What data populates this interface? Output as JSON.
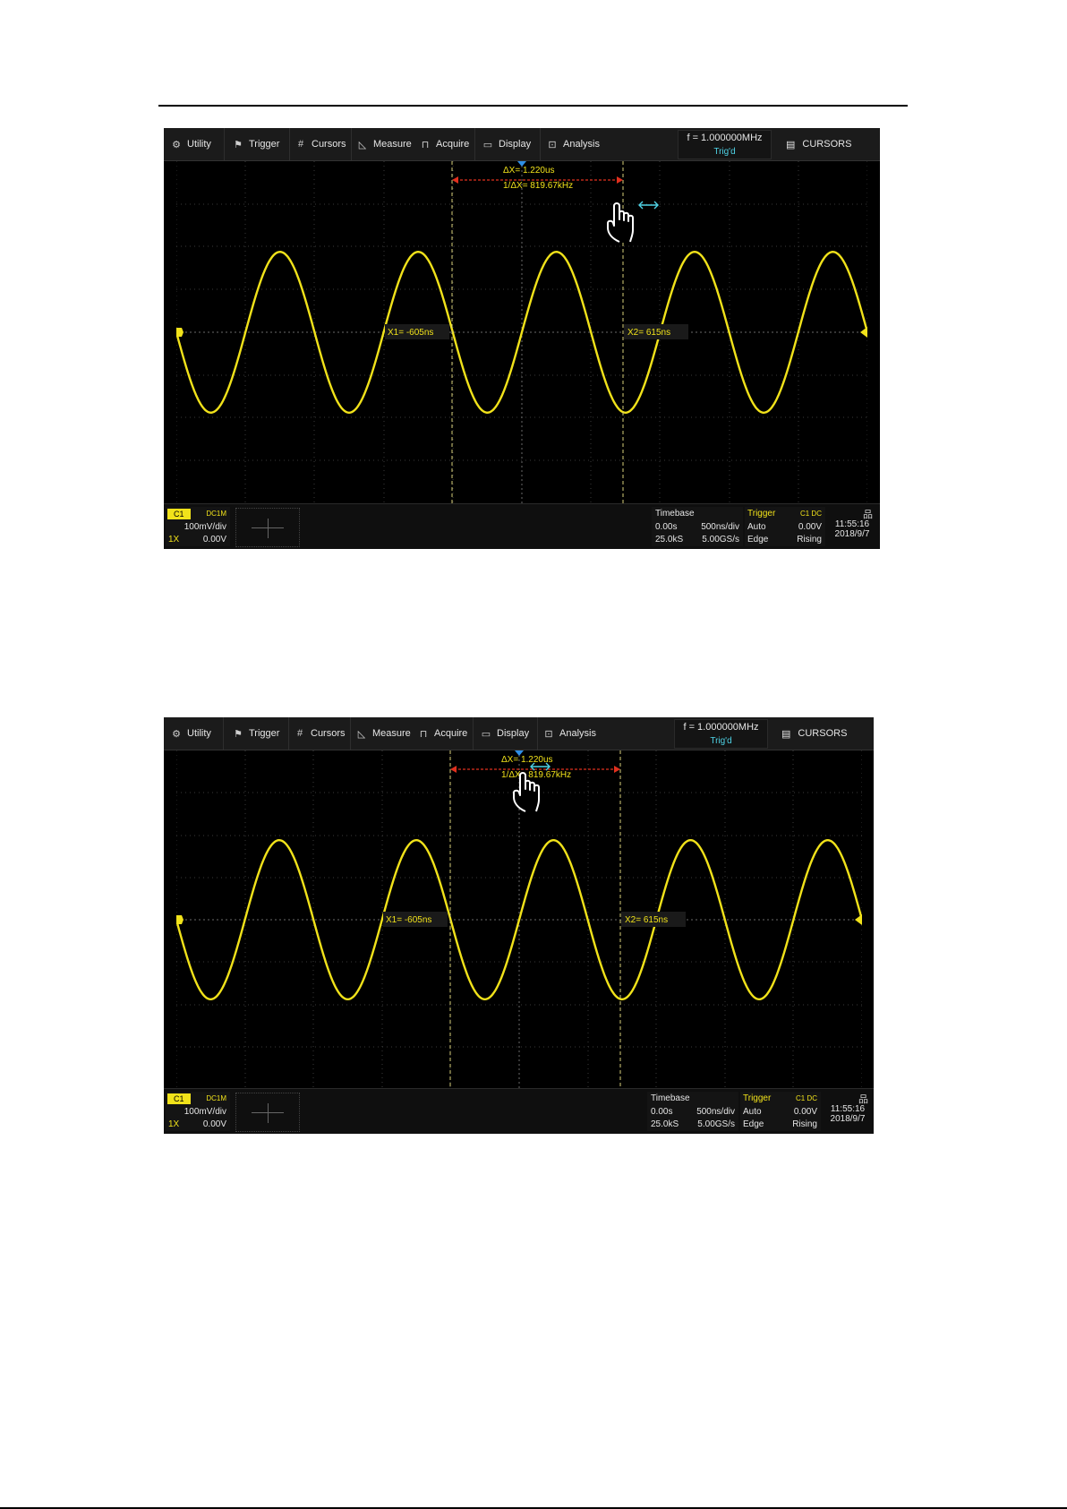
{
  "menubar": {
    "items": [
      {
        "label": "Utility",
        "icon": "gear-icon"
      },
      {
        "label": "Trigger",
        "icon": "flag-icon"
      },
      {
        "label": "Cursors",
        "icon": "grid-hash-icon"
      },
      {
        "label": "Measure",
        "icon": "ruler-triangle-icon"
      },
      {
        "label": "Acquire",
        "icon": "pulse-icon"
      },
      {
        "label": "Display",
        "icon": "monitor-icon"
      },
      {
        "label": "Analysis",
        "icon": "analysis-icon"
      }
    ],
    "frequency": "f = 1.000000MHz",
    "trigger_status": "Trig'd",
    "mode_button": "CURSORS"
  },
  "cursors": {
    "delta_x": "ΔX= 1.220us",
    "inverse_delta_x": "1/ΔX= 819.67kHz",
    "x1_label": "X1= -605ns",
    "x2_label": "X2= 615ns"
  },
  "channel": {
    "name": "C1",
    "coupling": "DC1M",
    "scale": "100mV/div",
    "probe": "1X",
    "offset": "0.00V"
  },
  "timebase": {
    "title": "Timebase",
    "delay": "0.00s",
    "scale": "500ns/div",
    "memory_depth": "25.0kS",
    "sample_rate": "5.00GS/s"
  },
  "trigger": {
    "title": "Trigger",
    "source": "C1 DC",
    "mode": "Auto",
    "level": "0.00V",
    "type": "Edge",
    "slope": "Rising"
  },
  "clock": {
    "time": "11:55:16",
    "date": "2018/9/7"
  },
  "colors": {
    "trace": "#f1e21a",
    "cursor_arrow": "#e0301e",
    "accent_cyan": "#4fd3e6",
    "background": "#000000"
  }
}
